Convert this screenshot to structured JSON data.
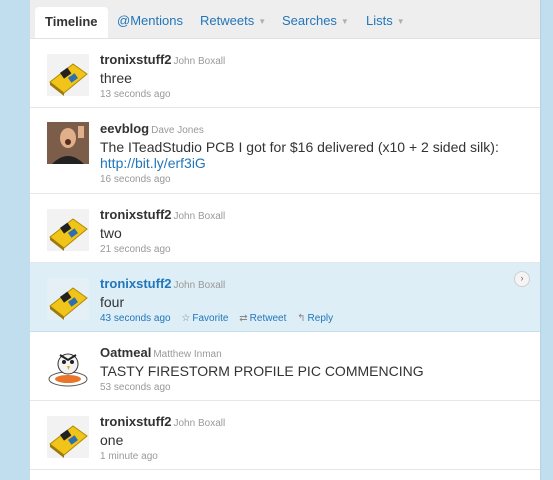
{
  "tabs": [
    {
      "label": "Timeline"
    },
    {
      "label": "@Mentions"
    },
    {
      "label": "Retweets"
    },
    {
      "label": "Searches"
    },
    {
      "label": "Lists"
    }
  ],
  "tab_caret": "▼",
  "tweets": [
    {
      "user": "tronixstuff2",
      "name": "John Boxall",
      "text": "three",
      "time": "13 seconds ago"
    },
    {
      "user": "eevblog",
      "name": "Dave Jones",
      "text": "The ITeadStudio PCB I got for $16 delivered (x10 + 2 sided silk):",
      "link": "http://bit.ly/erf3iG",
      "time": "16 seconds ago"
    },
    {
      "user": "tronixstuff2",
      "name": "John Boxall",
      "text": "two",
      "time": "21 seconds ago"
    },
    {
      "user": "tronixstuff2",
      "name": "John Boxall",
      "text": "four",
      "time": "43 seconds ago",
      "actions": {
        "favorite": "Favorite",
        "retweet": "Retweet",
        "reply": "Reply"
      }
    },
    {
      "user": "Oatmeal",
      "name": "Matthew Inman",
      "text": "TASTY FIRESTORM PROFILE PIC COMMENCING",
      "time": "53 seconds ago"
    },
    {
      "user": "tronixstuff2",
      "name": "John Boxall",
      "text": "one",
      "time": "1 minute ago"
    }
  ],
  "colors": {
    "accent": "#2276bb",
    "highlight": "#ddeef6",
    "background": "#c0deed"
  }
}
